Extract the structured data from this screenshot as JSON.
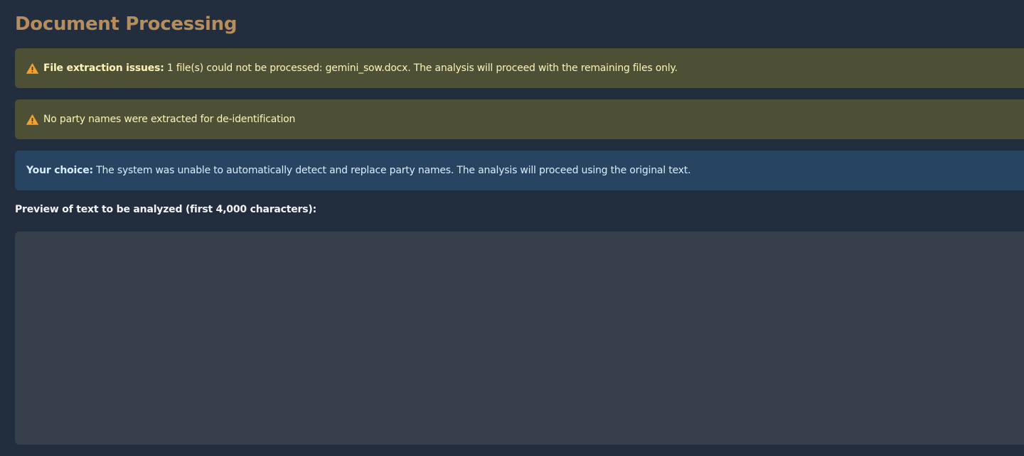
{
  "page": {
    "title": "Document Processing"
  },
  "alerts": [
    {
      "type": "warning",
      "icon": "warning-icon",
      "bold_text": "File extraction issues:",
      "text": " 1 file(s) could not be processed: gemini_sow.docx. The analysis will proceed with the remaining files only."
    },
    {
      "type": "warning",
      "icon": "warning-icon",
      "text": "No party names were extracted for de-identification"
    },
    {
      "type": "info",
      "bold_text": "Your choice:",
      "text": " The system was unable to automatically detect and replace party names. The analysis will proceed using the original text."
    }
  ],
  "preview": {
    "label": "Preview of text to be analyzed (first 4,000 characters):",
    "value": ""
  },
  "colors": {
    "background": "#222e3d",
    "title": "#b68e5e",
    "warning_bg": "#4e5036",
    "warning_text": "#fdf4b8",
    "warning_icon": "#f0a330",
    "info_bg": "#274563",
    "info_text": "#d9eefc",
    "textarea_bg": "#363f4a"
  }
}
